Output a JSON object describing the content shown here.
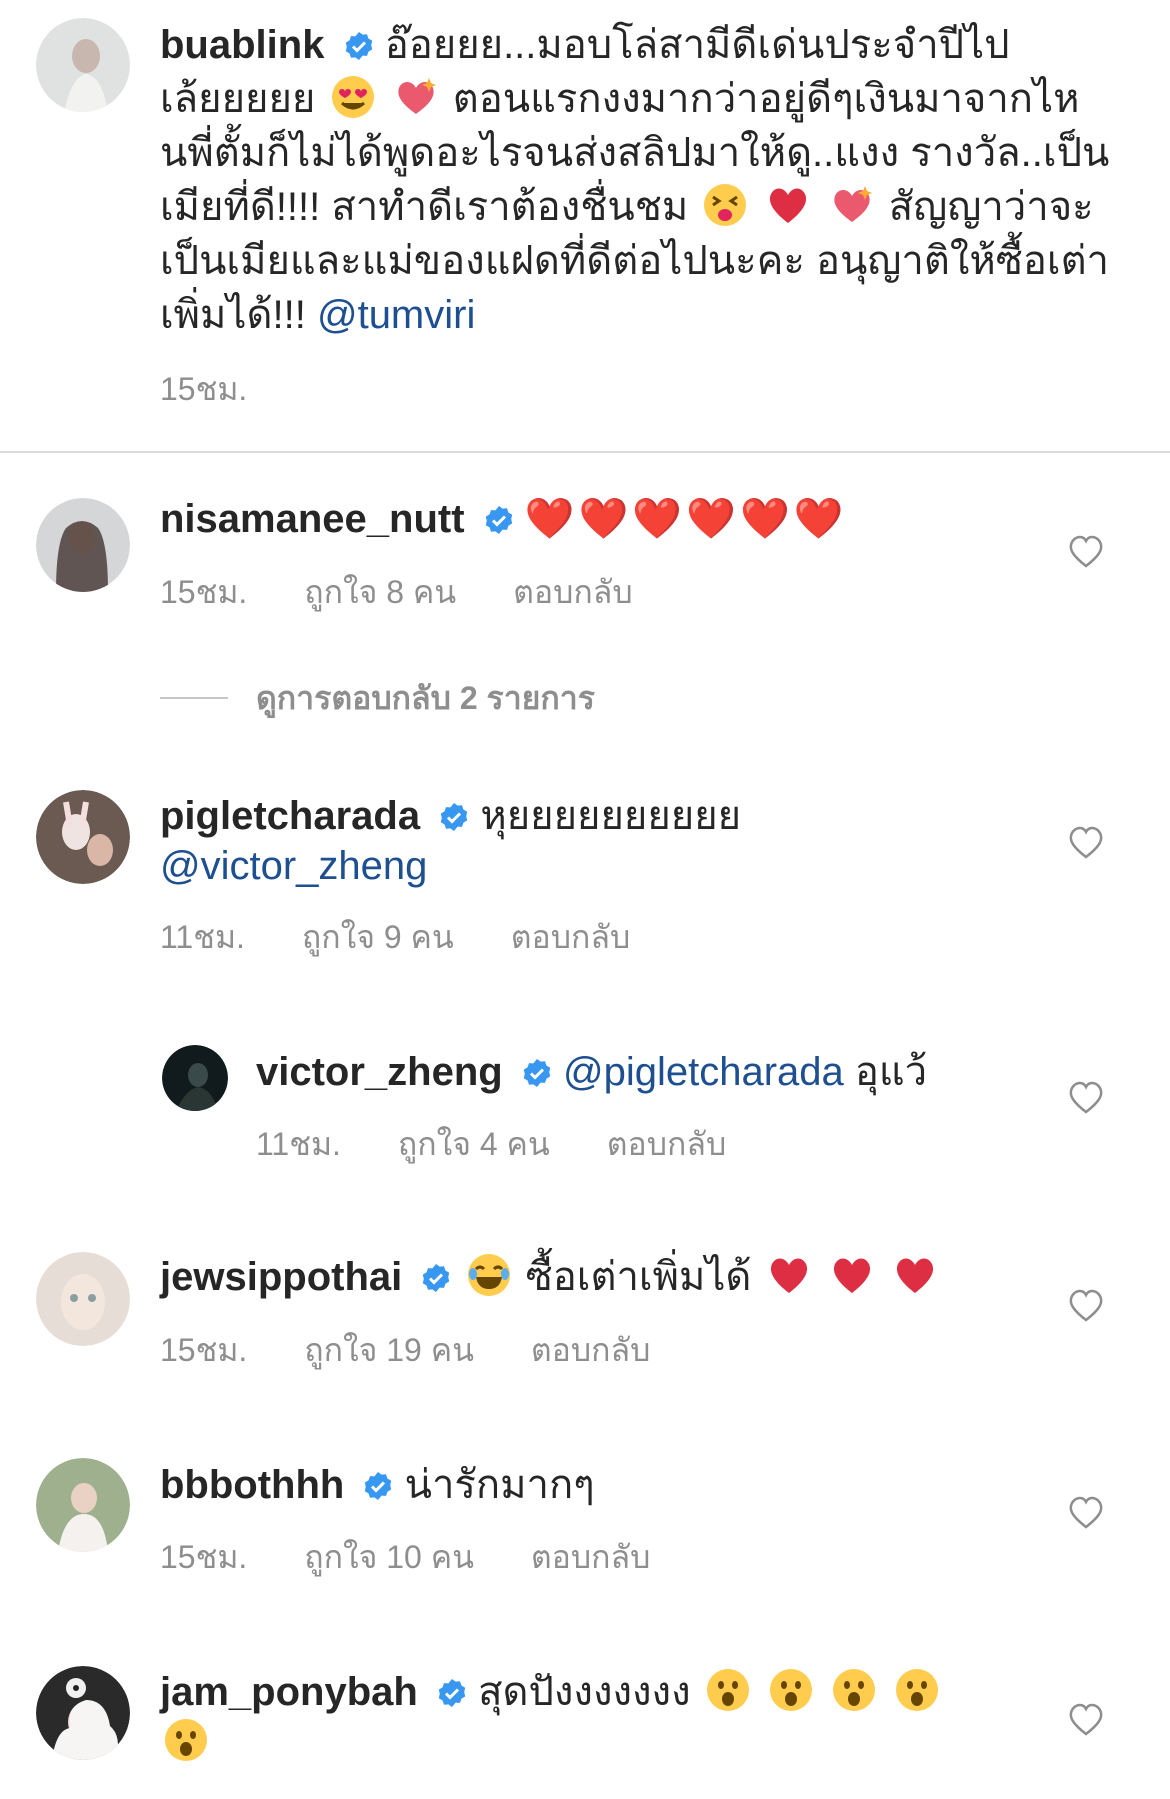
{
  "caption": {
    "username": "buablink",
    "text_before": "อ๊อยยย...มอบโล่สามีดีเด่นประจำปีไปเล้ยยยยย",
    "text_mid": " ตอนแรกงงมากว่าอยู่ดีๆเงินมาจากไหนพี่ตั้มก็ไม่ได้พูดอะไรจนส่งสลิปมาให้ดู..แงง รางวัล..เป็นเมียที่ดี!!!! สาทำดีเราต้องชื่นชม",
    "text_after": " สัญญาว่าจะเป็นเมียและแม่ของแฝดที่ดีต่อไปนะคะ อนุญาติให้ซื้อเต่าเพิ่มได้!!!",
    "mention": "@tumviri",
    "time": "15ชม."
  },
  "comments": [
    {
      "username": "nisamanee_nutt",
      "text": "❤️❤️❤️❤️❤️❤️",
      "time": "15ชม.",
      "likes": "ถูกใจ 8 คน",
      "reply": "ตอบกลับ"
    },
    {
      "username": "pigletcharada",
      "text": "หุยยยยยยยยยย",
      "mention": "@victor_zheng",
      "time": "11ชม.",
      "likes": "ถูกใจ 9 คน",
      "reply": "ตอบกลับ"
    },
    {
      "username": "victor_zheng",
      "mention": "@pigletcharada",
      "text": "อุแว้",
      "time": "11ชม.",
      "likes": "ถูกใจ 4 คน",
      "reply": "ตอบกลับ"
    },
    {
      "username": "jewsippothai",
      "text": "ซื้อเต่าเพิ่มได้",
      "time": "15ชม.",
      "likes": "ถูกใจ 19 คน",
      "reply": "ตอบกลับ"
    },
    {
      "username": "bbbothhh",
      "text": "น่ารักมากๆ",
      "time": "15ชม.",
      "likes": "ถูกใจ 10 คน",
      "reply": "ตอบกลับ"
    },
    {
      "username": "jam_ponybah",
      "text": "สุดปังงงงงงง"
    }
  ],
  "view_replies": "ดูการตอบกลับ 2 รายการ",
  "icons": {
    "verified": "verified-badge-icon",
    "heart": "heart-outline-icon",
    "colors": {
      "verified": "#3897f0",
      "mention": "#1d4f91",
      "meta": "#8e8e8e"
    }
  }
}
